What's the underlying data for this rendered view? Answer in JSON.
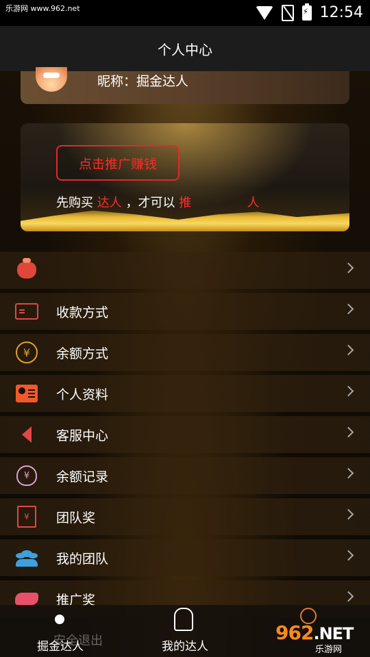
{
  "status_bar": {
    "watermark": "乐游网 www.962.net",
    "time": "12:54"
  },
  "header": {
    "title": "个人中心"
  },
  "profile": {
    "nickname": "昵称：掘金达人"
  },
  "promo": {
    "button": "点击推广赚钱",
    "text_prefix": "先购买",
    "text_highlight1": "达人",
    "text_middle": "，才可以",
    "text_highlight2": "推",
    "text_highlight3": "人"
  },
  "menu": [
    {
      "label": "",
      "icon": "money-bag-icon"
    },
    {
      "label": "收款方式",
      "icon": "card-icon"
    },
    {
      "label": "余额方式",
      "icon": "yen-coin-icon"
    },
    {
      "label": "个人资料",
      "icon": "id-card-icon"
    },
    {
      "label": "客服中心",
      "icon": "speaker-icon"
    },
    {
      "label": "余额记录",
      "icon": "money-pouch-icon"
    },
    {
      "label": "团队奖",
      "icon": "gift-icon"
    },
    {
      "label": "我的团队",
      "icon": "team-icon"
    },
    {
      "label": "推广奖",
      "icon": "handshake-icon"
    }
  ],
  "logout": "安全退出",
  "bottom_nav": [
    {
      "label": "掘金达人",
      "icon": "home-icon"
    },
    {
      "label": "我的达人",
      "icon": "user-check-icon"
    },
    {
      "label": "",
      "icon": "person-icon"
    }
  ],
  "site_logo": {
    "big": "962",
    "suffix": ".NET",
    "small": "乐游网"
  },
  "colors": {
    "highlight_red": "#ff2d2d",
    "header_bg": "#1c1c1c",
    "accent_gold": "#e0a030"
  }
}
